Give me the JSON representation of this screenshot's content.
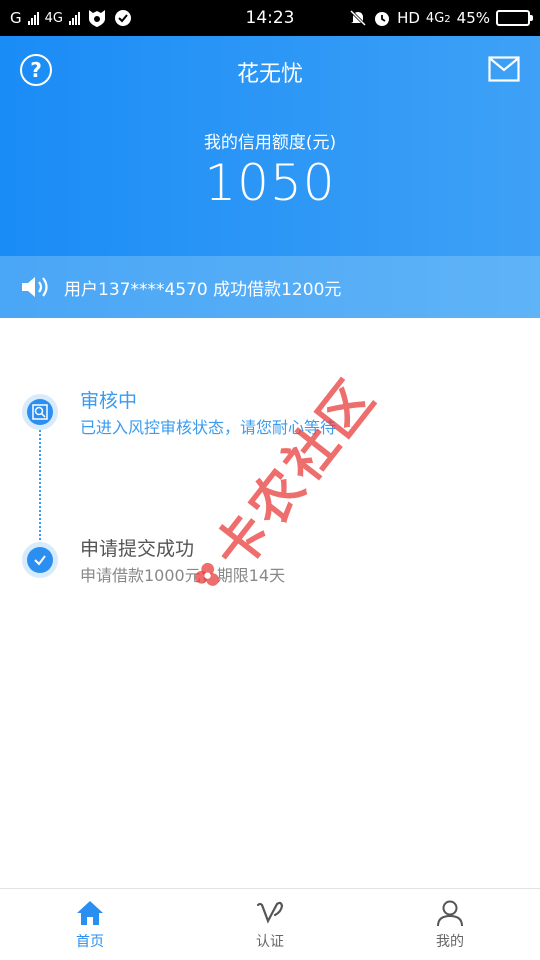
{
  "status_bar": {
    "carrier_1": "G",
    "carrier_2": "4G",
    "time": "14:23",
    "network": "HD",
    "network_2": "4G",
    "network_2_sub": "2",
    "battery": "45%",
    "battery_level": 0.45
  },
  "header": {
    "title": "花无忧",
    "help_symbol": "?",
    "credit_label": "我的信用额度(元)",
    "credit_amount": "1050"
  },
  "notice": {
    "text": "用户137****4570 成功借款1200元"
  },
  "timeline": {
    "items": [
      {
        "title": "审核中",
        "desc": "已进入风控审核状态，请您耐心等待",
        "icon": "search-review-icon"
      },
      {
        "title": "申请提交成功",
        "desc": "申请借款1000元，期限14天",
        "icon": "check-icon"
      }
    ]
  },
  "watermark": {
    "text": "卡农社区"
  },
  "nav": {
    "items": [
      {
        "label": "首页",
        "icon": "home-icon"
      },
      {
        "label": "认证",
        "icon": "verify-icon"
      },
      {
        "label": "我的",
        "icon": "user-icon"
      }
    ]
  },
  "colors": {
    "primary": "#2a8ff0",
    "header_start": "#1a8cf6",
    "header_end": "#3ea1f6",
    "watermark": "#e83c3c"
  }
}
